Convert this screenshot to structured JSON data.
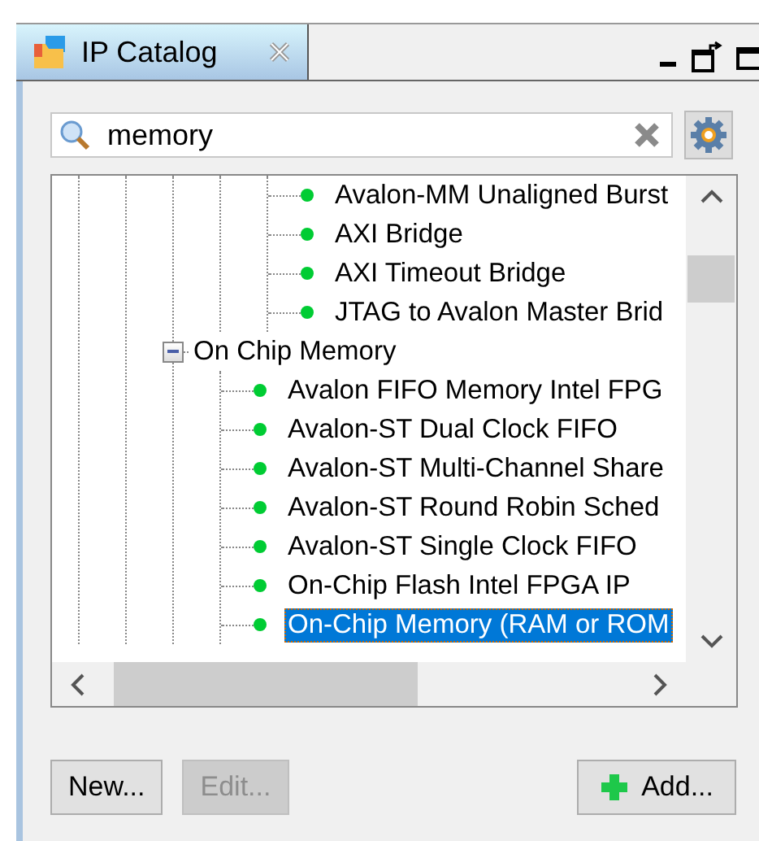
{
  "tab": {
    "title": "IP Catalog"
  },
  "search": {
    "value": "memory"
  },
  "tree": {
    "nodes": [
      {
        "children": [
          {
            "children": [
              {
                "children": [
                  {
                    "children": [
                      {
                        "label": "Avalon-MM Unaligned Burst",
                        "selected": false
                      },
                      {
                        "label": "AXI Bridge",
                        "selected": false
                      },
                      {
                        "label": "AXI Timeout Bridge",
                        "selected": false
                      },
                      {
                        "label": "JTAG to Avalon Master Brid",
                        "selected": false
                      }
                    ]
                  }
                ]
              },
              {
                "label": "On Chip Memory",
                "expanded": true,
                "children": [
                  {
                    "label": "Avalon FIFO Memory Intel FPG",
                    "selected": false
                  },
                  {
                    "label": "Avalon-ST Dual Clock FIFO",
                    "selected": false
                  },
                  {
                    "label": "Avalon-ST Multi-Channel Share",
                    "selected": false
                  },
                  {
                    "label": "Avalon-ST Round Robin Sched",
                    "selected": false
                  },
                  {
                    "label": "Avalon-ST Single Clock FIFO",
                    "selected": false
                  },
                  {
                    "label": "On-Chip Flash Intel FPGA IP",
                    "selected": false
                  },
                  {
                    "label": "On-Chip Memory (RAM or ROM",
                    "selected": true
                  }
                ]
              }
            ]
          }
        ]
      }
    ]
  },
  "buttons": [
    {
      "label": "New...",
      "disabled": false,
      "kind": "plain"
    },
    {
      "label": "Edit...",
      "disabled": true,
      "kind": "plain"
    },
    {
      "label": "Add...",
      "disabled": false,
      "kind": "add"
    }
  ]
}
